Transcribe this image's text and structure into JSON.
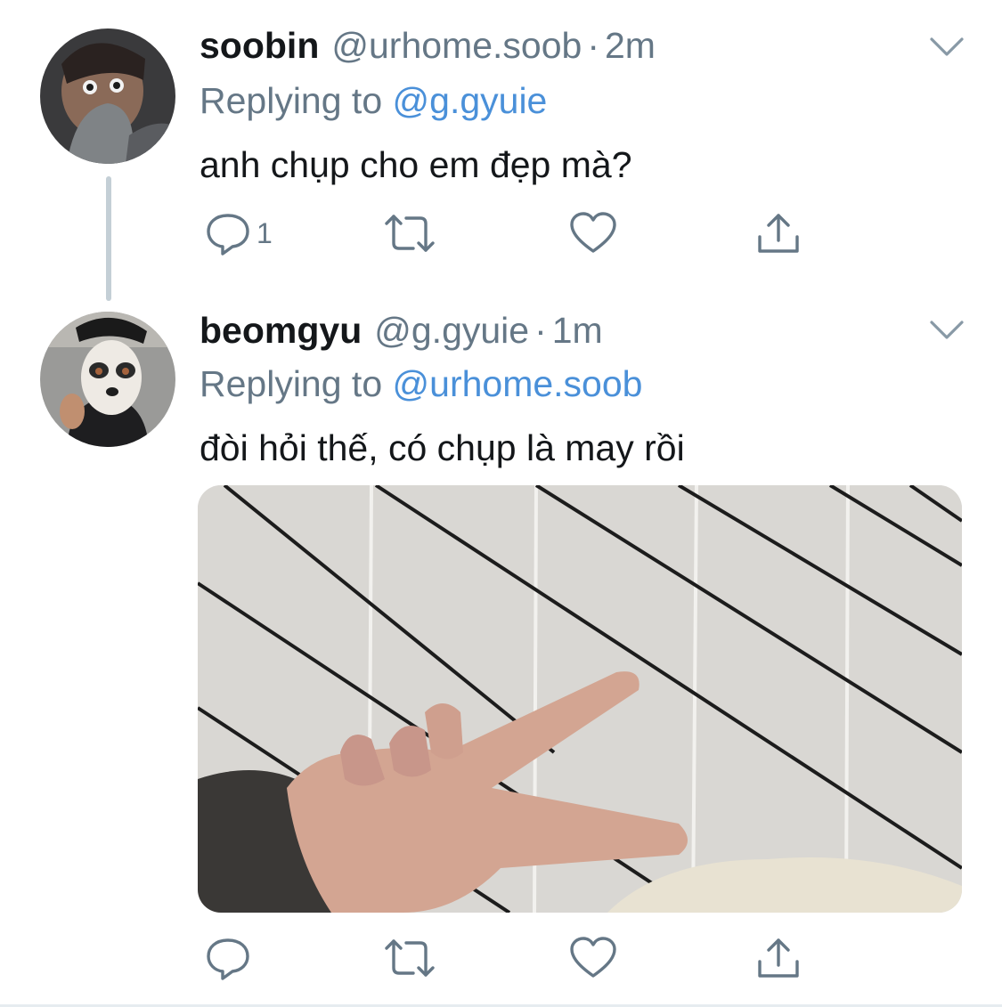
{
  "tweets": [
    {
      "display_name": "soobin",
      "handle": "@urhome.soob",
      "separator": "·",
      "time": "2m",
      "replying_prefix": "Replying to",
      "replying_to": "@g.gyuie",
      "text": "anh chụp cho em đẹp mà?",
      "reply_count": "1"
    },
    {
      "display_name": "beomgyu",
      "handle": "@g.gyuie",
      "separator": "·",
      "time": "1m",
      "replying_prefix": "Replying to",
      "replying_to": "@urhome.soob",
      "text": "đòi hỏi thế, có chụp là may rồi",
      "reply_count": ""
    }
  ],
  "icons": [
    "reply-icon",
    "retweet-icon",
    "like-icon",
    "share-icon",
    "chevron-down-icon"
  ],
  "colors": {
    "text": "#14171a",
    "secondary": "#657786",
    "link": "#4a90d9",
    "thread_line": "#c4cfd6"
  }
}
